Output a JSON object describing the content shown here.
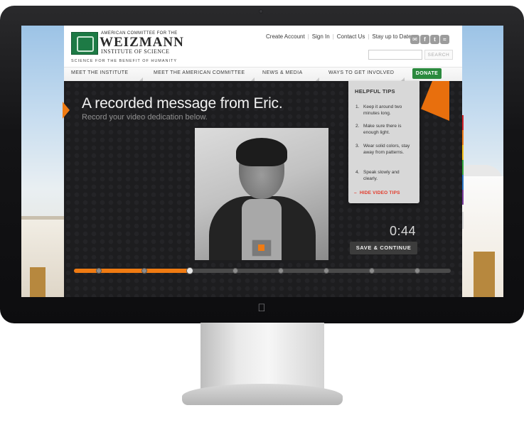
{
  "site": {
    "logo": {
      "line1": "AMERICAN COMMITTEE FOR THE",
      "line2": "WEIZMANN",
      "line3": "INSTITUTE OF SCIENCE"
    },
    "tagline": "SCIENCE FOR THE BENEFIT OF HUMANITY",
    "top_links": {
      "create_account": "Create Account",
      "sign_in": "Sign In",
      "contact_us": "Contact Us",
      "stay_up_to_date": "Stay up to Date:"
    },
    "social_icons": [
      "email-icon",
      "facebook-icon",
      "twitter-icon",
      "rss-icon"
    ],
    "search": {
      "placeholder": "",
      "button_label": "SEARCH"
    },
    "nav": [
      "MEET THE INSTITUTE",
      "MEET THE AMERICAN COMMITTEE",
      "NEWS & MEDIA",
      "WAYS TO GET INVOLVED"
    ],
    "donate_label": "DONATE"
  },
  "video_module": {
    "headline": "A recorded message from Eric.",
    "subhead": "Record your video dedication below.",
    "timer": "0:44",
    "save_label": "SAVE & CONTINUE",
    "progress": {
      "fraction": 0.31,
      "steps": 8,
      "current_step": 3
    },
    "accent_color": "#f07b12"
  },
  "tips": {
    "title": "HELPFUL TIPS",
    "items": [
      {
        "num": "1.",
        "text": "Keep it around two minutes long."
      },
      {
        "num": "2.",
        "text": "Make sure there is enough light."
      },
      {
        "num": "3.",
        "text": "Wear solid colors, stay away from patterns."
      },
      {
        "num": "4.",
        "text": "Speak slowly and clearly."
      }
    ],
    "hide_label": "HIDE VIDEO TIPS"
  },
  "side_colors": [
    "#d3242a",
    "#ef7a16",
    "#f5c21b",
    "#36a93f",
    "#2b77c9",
    "#7b3fa0"
  ]
}
